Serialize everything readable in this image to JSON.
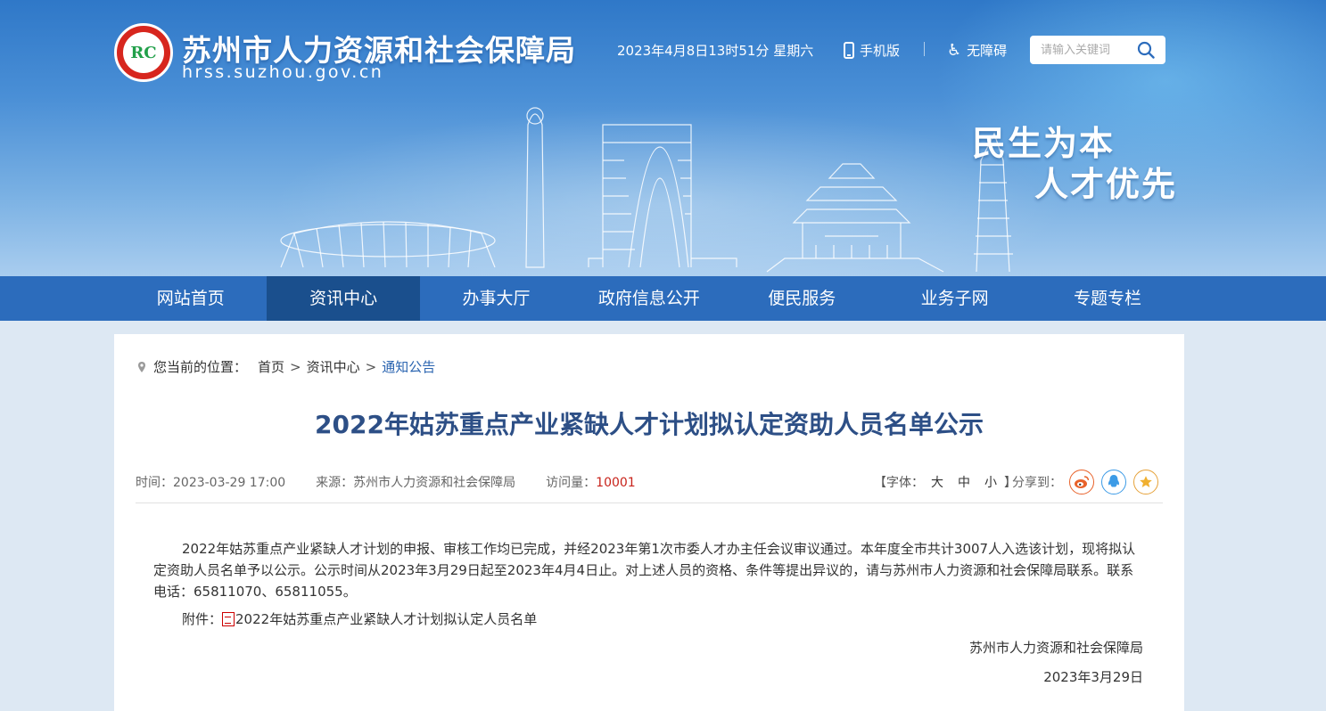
{
  "header": {
    "logo_text": "RC",
    "site_name": "苏州市人力资源和社会保障局",
    "site_domain": "hrss.suzhou.gov.cn",
    "datetime": "2023年4月8日13时51分 星期六",
    "mobile_label": "手机版",
    "accessible_label": "无障碍",
    "search_placeholder": "请输入关键词",
    "slogan_line1": "民生为本",
    "slogan_line2": "人才优先"
  },
  "nav": {
    "items": [
      {
        "label": "网站首页"
      },
      {
        "label": "资讯中心"
      },
      {
        "label": "办事大厅"
      },
      {
        "label": "政府信息公开"
      },
      {
        "label": "便民服务"
      },
      {
        "label": "业务子网"
      },
      {
        "label": "专题专栏"
      }
    ],
    "active_index": 1
  },
  "breadcrumb": {
    "prefix": "您当前的位置：",
    "items": [
      "首页",
      "资讯中心",
      "通知公告"
    ],
    "separator": ">"
  },
  "article": {
    "title": "2022年姑苏重点产业紧缺人才计划拟认定资助人员名单公示",
    "time_label": "时间：",
    "time_value": "2023-03-29 17:00",
    "source_label": "来源：",
    "source_value": "苏州市人力资源和社会保障局",
    "visits_label": "访问量：",
    "visits_value": "10001",
    "font_label_open": "【字体：",
    "font_sizes": [
      "大",
      "中",
      "小"
    ],
    "font_label_close": "】",
    "share_label": "分享到：",
    "body": "2022年姑苏重点产业紧缺人才计划的申报、审核工作均已完成，并经2023年第1次市委人才办主任会议审议通过。本年度全市共计3007人入选该计划，现将拟认定资助人员名单予以公示。公示时间从2023年3月29日起至2023年4月4日止。对上述人员的资格、条件等提出异议的，请与苏州市人力资源和社会保障局联系。联系电话：65811070、65811055。",
    "attachment_label": "附件：",
    "attachment_link": "2022年姑苏重点产业紧缺人才计划拟认定人员名单",
    "signature": "苏州市人力资源和社会保障局",
    "signature_date": "2023年3月29日"
  },
  "colors": {
    "nav_bg": "#2c6cbc",
    "nav_active": "#1a4f8d",
    "title": "#2d4f86",
    "visits": "#c8231b",
    "breadcrumb_current": "#2a64b0"
  }
}
